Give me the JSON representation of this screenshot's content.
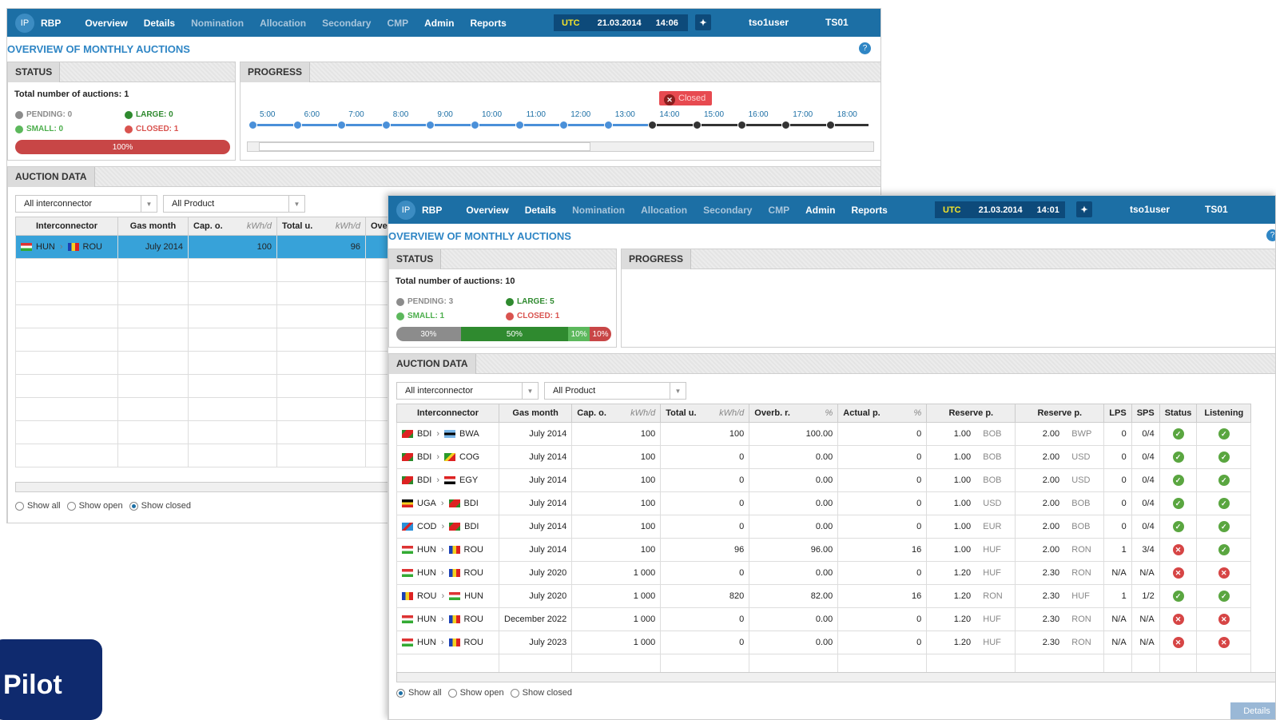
{
  "app_name": "RBP",
  "logo_text": "IP",
  "nav": [
    "Overview",
    "Details",
    "Nomination",
    "Allocation",
    "Secondary",
    "CMP",
    "Admin",
    "Reports"
  ],
  "utc_label": "UTC",
  "w1": {
    "date": "21.03.2014",
    "time": "14:06",
    "user": "tso1user",
    "tso": "TS01",
    "page_title": "OVERVIEW OF MONTHLY AUCTIONS",
    "status_tab": "STATUS",
    "progress_tab": "PROGRESS",
    "auction_tab": "AUCTION DATA",
    "total": "Total number of auctions: 1",
    "pending": "PENDING: 0",
    "large": "LARGE: 0",
    "small": "SMALL: 0",
    "closed": "CLOSED: 1",
    "bar_label": "100%",
    "times": [
      "5:00",
      "6:00",
      "7:00",
      "8:00",
      "9:00",
      "10:00",
      "11:00",
      "12:00",
      "13:00",
      "14:00",
      "15:00",
      "16:00",
      "17:00",
      "18:00"
    ],
    "tooltip": "Closed",
    "filter1": "All interconnector",
    "filter2": "All Product",
    "cols": [
      "Interconnector",
      "Gas month",
      "Cap. o.",
      "Total u.",
      "Ove"
    ],
    "unit": "kWh/d",
    "row": {
      "from": "HUN",
      "to": "ROU",
      "month": "July 2014",
      "cap": "100",
      "total": "96"
    },
    "radios": [
      "Show all",
      "Show open",
      "Show closed"
    ]
  },
  "w2": {
    "date": "21.03.2014",
    "time": "14:01",
    "user": "tso1user",
    "tso": "TS01",
    "page_title": "OVERVIEW OF MONTHLY AUCTIONS",
    "status_tab": "STATUS",
    "progress_tab": "PROGRESS",
    "auction_tab": "AUCTION DATA",
    "total": "Total number of auctions: 10",
    "pending": "PENDING: 3",
    "large": "LARGE: 5",
    "small": "SMALL: 1",
    "closed": "CLOSED: 1",
    "bar": [
      "30%",
      "50%",
      "10%",
      "10%"
    ],
    "filter1": "All interconnector",
    "filter2": "All Product",
    "cols": [
      "Interconnector",
      "Gas month",
      "Cap. o.",
      "Total u.",
      "Overb. r.",
      "Actual p.",
      "Reserve p.",
      "Reserve p.",
      "LPS",
      "SPS",
      "Status",
      "Listening"
    ],
    "unit_kwh": "kWh/d",
    "unit_pct": "%",
    "rows": [
      {
        "from": "BDI",
        "to": "BWA",
        "month": "July 2014",
        "cap": "100",
        "total": "100",
        "overb": "100.00",
        "actual": "0",
        "r1": "1.00",
        "c1": "BOB",
        "r2": "2.00",
        "c2": "BWP",
        "lps": "0",
        "sps": "0/4",
        "status": "ok",
        "listen": "ok"
      },
      {
        "from": "BDI",
        "to": "COG",
        "month": "July 2014",
        "cap": "100",
        "total": "0",
        "overb": "0.00",
        "actual": "0",
        "r1": "1.00",
        "c1": "BOB",
        "r2": "2.00",
        "c2": "USD",
        "lps": "0",
        "sps": "0/4",
        "status": "ok",
        "listen": "ok"
      },
      {
        "from": "BDI",
        "to": "EGY",
        "month": "July 2014",
        "cap": "100",
        "total": "0",
        "overb": "0.00",
        "actual": "0",
        "r1": "1.00",
        "c1": "BOB",
        "r2": "2.00",
        "c2": "USD",
        "lps": "0",
        "sps": "0/4",
        "status": "ok",
        "listen": "ok"
      },
      {
        "from": "UGA",
        "to": "BDI",
        "month": "July 2014",
        "cap": "100",
        "total": "0",
        "overb": "0.00",
        "actual": "0",
        "r1": "1.00",
        "c1": "USD",
        "r2": "2.00",
        "c2": "BOB",
        "lps": "0",
        "sps": "0/4",
        "status": "ok",
        "listen": "ok"
      },
      {
        "from": "COD",
        "to": "BDI",
        "month": "July 2014",
        "cap": "100",
        "total": "0",
        "overb": "0.00",
        "actual": "0",
        "r1": "1.00",
        "c1": "EUR",
        "r2": "2.00",
        "c2": "BOB",
        "lps": "0",
        "sps": "0/4",
        "status": "ok",
        "listen": "ok"
      },
      {
        "from": "HUN",
        "to": "ROU",
        "month": "July 2014",
        "cap": "100",
        "total": "96",
        "overb": "96.00",
        "actual": "16",
        "r1": "1.00",
        "c1": "HUF",
        "r2": "2.00",
        "c2": "RON",
        "lps": "1",
        "sps": "3/4",
        "status": "x",
        "listen": "ok"
      },
      {
        "from": "HUN",
        "to": "ROU",
        "month": "July 2020",
        "cap": "1 000",
        "total": "0",
        "overb": "0.00",
        "actual": "0",
        "r1": "1.20",
        "c1": "HUF",
        "r2": "2.30",
        "c2": "RON",
        "lps": "N/A",
        "sps": "N/A",
        "status": "x",
        "listen": "x"
      },
      {
        "from": "ROU",
        "to": "HUN",
        "month": "July 2020",
        "cap": "1 000",
        "total": "820",
        "overb": "82.00",
        "actual": "16",
        "r1": "1.20",
        "c1": "RON",
        "r2": "2.30",
        "c2": "HUF",
        "lps": "1",
        "sps": "1/2",
        "status": "ok",
        "listen": "ok"
      },
      {
        "from": "HUN",
        "to": "ROU",
        "month": "December 2022",
        "cap": "1 000",
        "total": "0",
        "overb": "0.00",
        "actual": "0",
        "r1": "1.20",
        "c1": "HUF",
        "r2": "2.30",
        "c2": "RON",
        "lps": "N/A",
        "sps": "N/A",
        "status": "x",
        "listen": "x"
      },
      {
        "from": "HUN",
        "to": "ROU",
        "month": "July 2023",
        "cap": "1 000",
        "total": "0",
        "overb": "0.00",
        "actual": "0",
        "r1": "1.20",
        "c1": "HUF",
        "r2": "2.30",
        "c2": "RON",
        "lps": "N/A",
        "sps": "N/A",
        "status": "x",
        "listen": "x"
      }
    ],
    "radios": [
      "Show all",
      "Show open",
      "Show closed"
    ],
    "details_btn": "Details"
  },
  "pilot": "Pilot",
  "colors": {
    "topbar": "#1c6fa5",
    "accent": "#2f86c5",
    "pending": "#8c8c8c",
    "large": "#2f8a2f",
    "small": "#5cb85c",
    "closed": "#d9534f"
  }
}
